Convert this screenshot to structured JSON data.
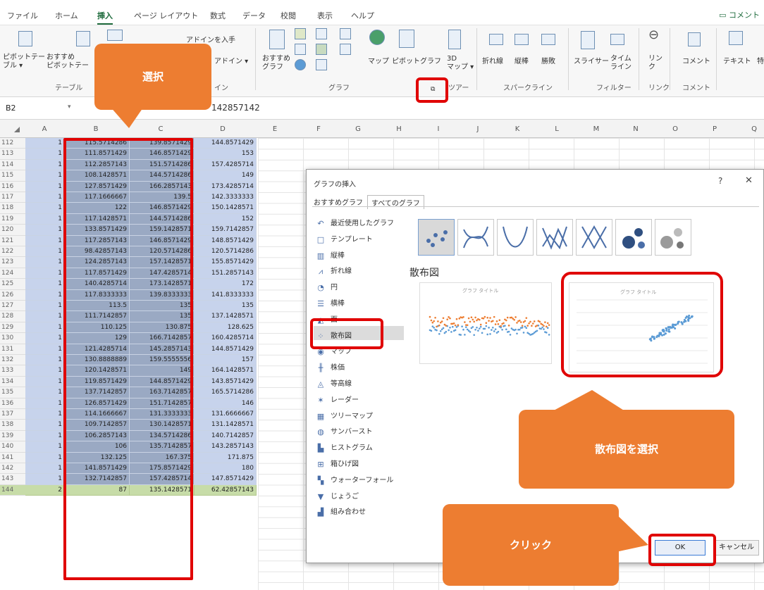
{
  "ribbon_tabs": [
    "ファイル",
    "ホーム",
    "挿入",
    "ページ レイアウト",
    "数式",
    "データ",
    "校閲",
    "表示",
    "ヘルプ"
  ],
  "comment_button": "コメント",
  "ribbon": {
    "pivot1": "ピボットテー\nブル ▾",
    "pivot2": "おすすめ\nピボットテー",
    "addin_get": "アドインを入手",
    "addin_my": "アドイン ▾",
    "osusume_graph": "おすすめ\nグラフ",
    "map": "マップ",
    "pivot_graph": "ピボットグラフ",
    "map3d": "3D\nマップ ▾",
    "spark_line": "折れ線",
    "spark_col": "縦棒",
    "spark_winloss": "勝敗",
    "slicer": "スライサー",
    "timeline": "タイム\nライン",
    "link": "リン\nク",
    "comment": "コメント",
    "text": "テキスト",
    "special": "特",
    "groups": {
      "table": "テーブル",
      "graph": "グラフ",
      "tour": "ツアー",
      "sparkline": "スパークライン",
      "filter": "フィルター",
      "link": "リンク",
      "comment": "コメント",
      "addin": "イン"
    }
  },
  "namebox": "B2",
  "formula_value": "142857142",
  "columns": [
    "A",
    "B",
    "C",
    "D",
    "E",
    "F",
    "G",
    "H",
    "I",
    "J",
    "K",
    "L",
    "M",
    "N",
    "O",
    "P",
    "Q"
  ],
  "rows": [
    {
      "n": "112",
      "a": "1",
      "b": "115.5714286",
      "c": "139.8571429",
      "d": "144.8571429"
    },
    {
      "n": "113",
      "a": "1",
      "b": "111.8571429",
      "c": "146.8571429",
      "d": "153"
    },
    {
      "n": "114",
      "a": "1",
      "b": "112.2857143",
      "c": "151.5714286",
      "d": "157.4285714"
    },
    {
      "n": "115",
      "a": "1",
      "b": "108.1428571",
      "c": "144.5714286",
      "d": "149"
    },
    {
      "n": "116",
      "a": "1",
      "b": "127.8571429",
      "c": "166.2857143",
      "d": "173.4285714"
    },
    {
      "n": "117",
      "a": "1",
      "b": "117.1666667",
      "c": "139.5",
      "d": "142.3333333"
    },
    {
      "n": "118",
      "a": "1",
      "b": "122",
      "c": "146.8571429",
      "d": "150.1428571"
    },
    {
      "n": "119",
      "a": "1",
      "b": "117.1428571",
      "c": "144.5714286",
      "d": "152"
    },
    {
      "n": "120",
      "a": "1",
      "b": "133.8571429",
      "c": "159.1428571",
      "d": "159.7142857"
    },
    {
      "n": "121",
      "a": "1",
      "b": "117.2857143",
      "c": "146.8571429",
      "d": "148.8571429"
    },
    {
      "n": "122",
      "a": "1",
      "b": "98.42857143",
      "c": "120.5714286",
      "d": "120.5714286"
    },
    {
      "n": "123",
      "a": "1",
      "b": "124.2857143",
      "c": "157.1428571",
      "d": "155.8571429"
    },
    {
      "n": "124",
      "a": "1",
      "b": "117.8571429",
      "c": "147.4285714",
      "d": "151.2857143"
    },
    {
      "n": "125",
      "a": "1",
      "b": "140.4285714",
      "c": "173.1428571",
      "d": "172"
    },
    {
      "n": "126",
      "a": "1",
      "b": "117.8333333",
      "c": "139.8333333",
      "d": "141.8333333"
    },
    {
      "n": "127",
      "a": "1",
      "b": "113.5",
      "c": "135",
      "d": "135"
    },
    {
      "n": "128",
      "a": "1",
      "b": "111.7142857",
      "c": "135",
      "d": "137.1428571"
    },
    {
      "n": "129",
      "a": "1",
      "b": "110.125",
      "c": "130.875",
      "d": "128.625"
    },
    {
      "n": "130",
      "a": "1",
      "b": "129",
      "c": "166.7142857",
      "d": "160.4285714"
    },
    {
      "n": "131",
      "a": "1",
      "b": "121.4285714",
      "c": "145.2857143",
      "d": "144.8571429"
    },
    {
      "n": "132",
      "a": "1",
      "b": "130.8888889",
      "c": "159.5555556",
      "d": "157"
    },
    {
      "n": "133",
      "a": "1",
      "b": "120.1428571",
      "c": "149",
      "d": "164.1428571"
    },
    {
      "n": "134",
      "a": "1",
      "b": "119.8571429",
      "c": "144.8571429",
      "d": "143.8571429"
    },
    {
      "n": "135",
      "a": "1",
      "b": "137.7142857",
      "c": "163.7142857",
      "d": "165.5714286"
    },
    {
      "n": "136",
      "a": "1",
      "b": "126.8571429",
      "c": "151.7142857",
      "d": "146"
    },
    {
      "n": "137",
      "a": "1",
      "b": "114.1666667",
      "c": "131.3333333",
      "d": "131.6666667"
    },
    {
      "n": "138",
      "a": "1",
      "b": "109.7142857",
      "c": "130.1428571",
      "d": "131.1428571"
    },
    {
      "n": "139",
      "a": "1",
      "b": "106.2857143",
      "c": "134.5714286",
      "d": "140.7142857"
    },
    {
      "n": "140",
      "a": "1",
      "b": "106",
      "c": "135.7142857",
      "d": "143.2857143"
    },
    {
      "n": "141",
      "a": "1",
      "b": "132.125",
      "c": "167.375",
      "d": "171.875"
    },
    {
      "n": "142",
      "a": "1",
      "b": "141.8571429",
      "c": "175.8571429",
      "d": "180"
    },
    {
      "n": "143",
      "a": "1",
      "b": "132.7142857",
      "c": "157.4285714",
      "d": "147.8571429"
    },
    {
      "n": "144",
      "a": "2",
      "b": "87",
      "c": "135.1428571",
      "d": "62.42857143"
    }
  ],
  "dialog": {
    "title": "グラフの挿入",
    "help": "?",
    "close": "✕",
    "tab_recommended": "おすすめグラフ",
    "tab_all": "すべてのグラフ",
    "section_title": "散布図",
    "preview_title": "グラフ タイトル",
    "ok": "OK",
    "cancel": "キャンセル",
    "categories": [
      {
        "icon": "recent-icon",
        "glyph": "↶",
        "label": "最近使用したグラフ"
      },
      {
        "icon": "template-icon",
        "glyph": "□",
        "label": "テンプレート"
      },
      {
        "icon": "column-chart-icon",
        "glyph": "▥",
        "label": "縦棒"
      },
      {
        "icon": "line-chart-icon",
        "glyph": "⩘",
        "label": "折れ線"
      },
      {
        "icon": "pie-chart-icon",
        "glyph": "◔",
        "label": "円"
      },
      {
        "icon": "bar-chart-icon",
        "glyph": "☰",
        "label": "横棒"
      },
      {
        "icon": "area-chart-icon",
        "glyph": "◭",
        "label": "面"
      },
      {
        "icon": "scatter-chart-icon",
        "glyph": "⁘",
        "label": "散布図"
      },
      {
        "icon": "map-chart-icon",
        "glyph": "◉",
        "label": "マップ"
      },
      {
        "icon": "stock-chart-icon",
        "glyph": "╫",
        "label": "株価"
      },
      {
        "icon": "surface-chart-icon",
        "glyph": "◬",
        "label": "等高線"
      },
      {
        "icon": "radar-chart-icon",
        "glyph": "✶",
        "label": "レーダー"
      },
      {
        "icon": "treemap-icon",
        "glyph": "▦",
        "label": "ツリーマップ"
      },
      {
        "icon": "sunburst-icon",
        "glyph": "◍",
        "label": "サンバースト"
      },
      {
        "icon": "histogram-icon",
        "glyph": "▙",
        "label": "ヒストグラム"
      },
      {
        "icon": "boxwhisker-icon",
        "glyph": "⊞",
        "label": "箱ひげ図"
      },
      {
        "icon": "waterfall-icon",
        "glyph": "▚",
        "label": "ウォーターフォール"
      },
      {
        "icon": "funnel-icon",
        "glyph": "▼",
        "label": "じょうご"
      },
      {
        "icon": "combo-chart-icon",
        "glyph": "▟",
        "label": "組み合わせ"
      }
    ]
  },
  "callouts": {
    "select": "選択",
    "scatter": "散布図を選択",
    "click": "クリック"
  },
  "colors": {
    "accent": "#1e6b3c",
    "callout": "#ed7d31",
    "highlight": "#e00000",
    "selection": "#9aa9c3",
    "cell": "#c7d3ec",
    "series1": "#5b9bd5",
    "series2": "#ed7d31"
  }
}
